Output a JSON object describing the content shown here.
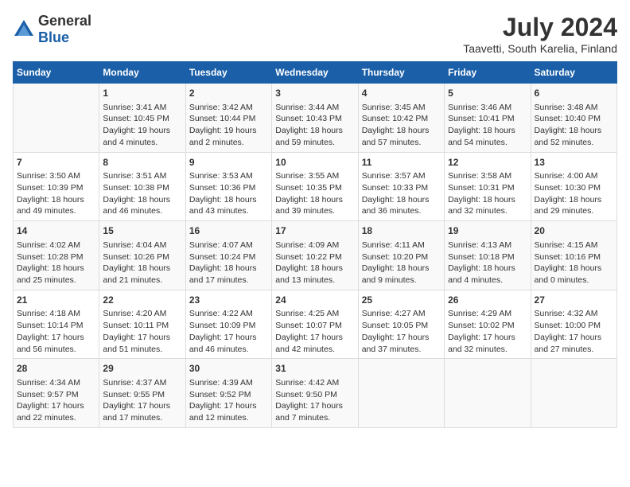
{
  "header": {
    "logo_general": "General",
    "logo_blue": "Blue",
    "title": "July 2024",
    "subtitle": "Taavetti, South Karelia, Finland"
  },
  "days_of_week": [
    "Sunday",
    "Monday",
    "Tuesday",
    "Wednesday",
    "Thursday",
    "Friday",
    "Saturday"
  ],
  "weeks": [
    [
      {
        "day": "",
        "info": ""
      },
      {
        "day": "1",
        "info": "Sunrise: 3:41 AM\nSunset: 10:45 PM\nDaylight: 19 hours\nand 4 minutes."
      },
      {
        "day": "2",
        "info": "Sunrise: 3:42 AM\nSunset: 10:44 PM\nDaylight: 19 hours\nand 2 minutes."
      },
      {
        "day": "3",
        "info": "Sunrise: 3:44 AM\nSunset: 10:43 PM\nDaylight: 18 hours\nand 59 minutes."
      },
      {
        "day": "4",
        "info": "Sunrise: 3:45 AM\nSunset: 10:42 PM\nDaylight: 18 hours\nand 57 minutes."
      },
      {
        "day": "5",
        "info": "Sunrise: 3:46 AM\nSunset: 10:41 PM\nDaylight: 18 hours\nand 54 minutes."
      },
      {
        "day": "6",
        "info": "Sunrise: 3:48 AM\nSunset: 10:40 PM\nDaylight: 18 hours\nand 52 minutes."
      }
    ],
    [
      {
        "day": "7",
        "info": "Sunrise: 3:50 AM\nSunset: 10:39 PM\nDaylight: 18 hours\nand 49 minutes."
      },
      {
        "day": "8",
        "info": "Sunrise: 3:51 AM\nSunset: 10:38 PM\nDaylight: 18 hours\nand 46 minutes."
      },
      {
        "day": "9",
        "info": "Sunrise: 3:53 AM\nSunset: 10:36 PM\nDaylight: 18 hours\nand 43 minutes."
      },
      {
        "day": "10",
        "info": "Sunrise: 3:55 AM\nSunset: 10:35 PM\nDaylight: 18 hours\nand 39 minutes."
      },
      {
        "day": "11",
        "info": "Sunrise: 3:57 AM\nSunset: 10:33 PM\nDaylight: 18 hours\nand 36 minutes."
      },
      {
        "day": "12",
        "info": "Sunrise: 3:58 AM\nSunset: 10:31 PM\nDaylight: 18 hours\nand 32 minutes."
      },
      {
        "day": "13",
        "info": "Sunrise: 4:00 AM\nSunset: 10:30 PM\nDaylight: 18 hours\nand 29 minutes."
      }
    ],
    [
      {
        "day": "14",
        "info": "Sunrise: 4:02 AM\nSunset: 10:28 PM\nDaylight: 18 hours\nand 25 minutes."
      },
      {
        "day": "15",
        "info": "Sunrise: 4:04 AM\nSunset: 10:26 PM\nDaylight: 18 hours\nand 21 minutes."
      },
      {
        "day": "16",
        "info": "Sunrise: 4:07 AM\nSunset: 10:24 PM\nDaylight: 18 hours\nand 17 minutes."
      },
      {
        "day": "17",
        "info": "Sunrise: 4:09 AM\nSunset: 10:22 PM\nDaylight: 18 hours\nand 13 minutes."
      },
      {
        "day": "18",
        "info": "Sunrise: 4:11 AM\nSunset: 10:20 PM\nDaylight: 18 hours\nand 9 minutes."
      },
      {
        "day": "19",
        "info": "Sunrise: 4:13 AM\nSunset: 10:18 PM\nDaylight: 18 hours\nand 4 minutes."
      },
      {
        "day": "20",
        "info": "Sunrise: 4:15 AM\nSunset: 10:16 PM\nDaylight: 18 hours\nand 0 minutes."
      }
    ],
    [
      {
        "day": "21",
        "info": "Sunrise: 4:18 AM\nSunset: 10:14 PM\nDaylight: 17 hours\nand 56 minutes."
      },
      {
        "day": "22",
        "info": "Sunrise: 4:20 AM\nSunset: 10:11 PM\nDaylight: 17 hours\nand 51 minutes."
      },
      {
        "day": "23",
        "info": "Sunrise: 4:22 AM\nSunset: 10:09 PM\nDaylight: 17 hours\nand 46 minutes."
      },
      {
        "day": "24",
        "info": "Sunrise: 4:25 AM\nSunset: 10:07 PM\nDaylight: 17 hours\nand 42 minutes."
      },
      {
        "day": "25",
        "info": "Sunrise: 4:27 AM\nSunset: 10:05 PM\nDaylight: 17 hours\nand 37 minutes."
      },
      {
        "day": "26",
        "info": "Sunrise: 4:29 AM\nSunset: 10:02 PM\nDaylight: 17 hours\nand 32 minutes."
      },
      {
        "day": "27",
        "info": "Sunrise: 4:32 AM\nSunset: 10:00 PM\nDaylight: 17 hours\nand 27 minutes."
      }
    ],
    [
      {
        "day": "28",
        "info": "Sunrise: 4:34 AM\nSunset: 9:57 PM\nDaylight: 17 hours\nand 22 minutes."
      },
      {
        "day": "29",
        "info": "Sunrise: 4:37 AM\nSunset: 9:55 PM\nDaylight: 17 hours\nand 17 minutes."
      },
      {
        "day": "30",
        "info": "Sunrise: 4:39 AM\nSunset: 9:52 PM\nDaylight: 17 hours\nand 12 minutes."
      },
      {
        "day": "31",
        "info": "Sunrise: 4:42 AM\nSunset: 9:50 PM\nDaylight: 17 hours\nand 7 minutes."
      },
      {
        "day": "",
        "info": ""
      },
      {
        "day": "",
        "info": ""
      },
      {
        "day": "",
        "info": ""
      }
    ]
  ]
}
